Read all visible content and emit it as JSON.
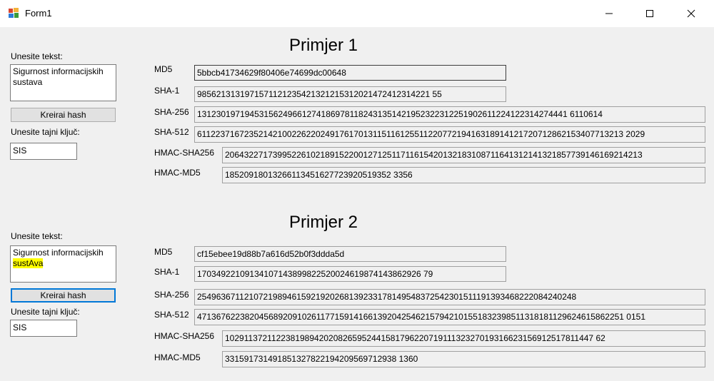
{
  "window": {
    "title": "Form1"
  },
  "example1": {
    "heading": "Primjer 1",
    "input_label": "Unesite tekst:",
    "input_text": "Sigurnost informacijskih sustava",
    "button_label": "Kreirai hash",
    "key_label": "Unesite tajni ključ:",
    "key_value": "SIS",
    "hashes": [
      {
        "label": "MD5",
        "value": "5bbcb41734629f80406e74699dc00648"
      },
      {
        "label": "SHA-1",
        "value": "9856213131971571121235421321215312021472412314221 55"
      },
      {
        "label": "SHA-256",
        "value": "131230197194531562496612741869781182431351421952322312251902611224122314274441 6110614"
      },
      {
        "label": "SHA-512",
        "value": "611223716723521421002262202491761701311511612551122077219416318914121720712862153407713213 2029"
      },
      {
        "label": "HMAC-SHA256",
        "value": "2064322717399522610218915220012712511711615420132183108711641312141321857739146169214213"
      },
      {
        "label": "HMAC-MD5",
        "value": "18520918013266113451627723920519352 3356"
      }
    ]
  },
  "example2": {
    "heading": "Primjer 2",
    "input_label": "Unesite tekst:",
    "input_text_line1": "Sigurnost informacijskih",
    "input_text_line2": "sustAva",
    "button_label": "Kreirai hash",
    "key_label": "Unesite tajni ključ:",
    "key_value": "SIS",
    "hashes": [
      {
        "label": "MD5",
        "value": "cf15ebee19d88b7a616d52b0f3ddda5d"
      },
      {
        "label": "SHA-1",
        "value": "17034922109134107143899822520024619874143862926 79"
      },
      {
        "label": "SHA-256",
        "value": "25496367112107219894615921920268139233178149548372542301511191393468222084240248"
      },
      {
        "label": "SHA-512",
        "value": "471367622382045689209102611771591416613920425462157942101551832398511318181129624615862251 0151"
      },
      {
        "label": "HMAC-SHA256",
        "value": "102911372112238198942020826595244158179622071911132327019316623156912517811447 62"
      },
      {
        "label": "HMAC-MD5",
        "value": "331591731491851327822194209569712938 1360"
      }
    ]
  }
}
